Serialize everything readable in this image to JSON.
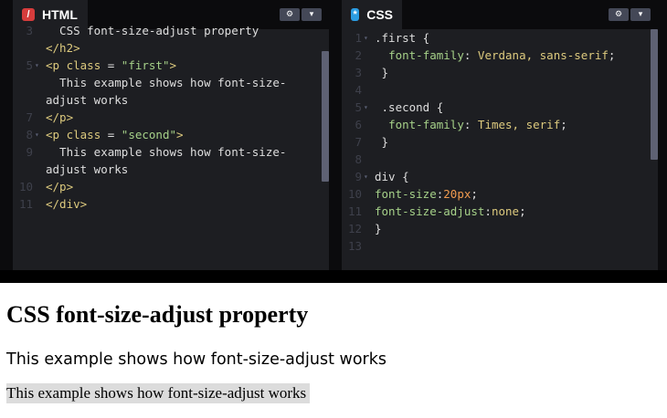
{
  "colors": {
    "tag": "#ddca7e",
    "attr": "#ddca7e",
    "string": "#a6d189",
    "property": "#a6d189",
    "number": "#f09a4f",
    "text": "#dedede",
    "html_icon": "#d63c3c",
    "css_icon": "#2b9de3",
    "second_paragraph_highlight": "#dcdcdc"
  },
  "html_pane": {
    "tab_label": "HTML",
    "icon": "html-slash-icon",
    "icon_glyph": "/",
    "lines": [
      {
        "num": "3",
        "fold": "",
        "text": "  CSS font-size-adjust property"
      },
      {
        "num": "",
        "fold": "",
        "text": "</h2>"
      },
      {
        "num": "5",
        "fold": "▾",
        "text": "<p class = \"first\">"
      },
      {
        "num": "",
        "fold": "",
        "text": "  This example shows how font-size-"
      },
      {
        "num": "",
        "fold": "",
        "text": "adjust works"
      },
      {
        "num": "7",
        "fold": "",
        "text": "</p>"
      },
      {
        "num": "8",
        "fold": "▾",
        "text": "<p class = \"second\">"
      },
      {
        "num": "9",
        "fold": "",
        "text": "  This example shows how font-size-"
      },
      {
        "num": "",
        "fold": "",
        "text": "adjust works"
      },
      {
        "num": "10",
        "fold": "",
        "text": "</p>"
      },
      {
        "num": "11",
        "fold": "",
        "text": "</div>"
      }
    ]
  },
  "css_pane": {
    "tab_label": "CSS",
    "icon": "css-asterisk-icon",
    "icon_glyph": "*",
    "lines": [
      {
        "num": "1",
        "fold": "▾",
        "text": ".first {"
      },
      {
        "num": "2",
        "fold": "",
        "text": "  font-family: Verdana, sans-serif;"
      },
      {
        "num": "3",
        "fold": "",
        "text": " }"
      },
      {
        "num": "4",
        "fold": "",
        "text": ""
      },
      {
        "num": "5",
        "fold": "▾",
        "text": " .second {"
      },
      {
        "num": "6",
        "fold": "",
        "text": "  font-family: Times, serif;"
      },
      {
        "num": "7",
        "fold": "",
        "text": " }"
      },
      {
        "num": "8",
        "fold": "",
        "text": ""
      },
      {
        "num": "9",
        "fold": "▾",
        "text": "div {"
      },
      {
        "num": "10",
        "fold": "",
        "text": "font-size:20px;"
      },
      {
        "num": "11",
        "fold": "",
        "text": "font-size-adjust:none;"
      },
      {
        "num": "12",
        "fold": "",
        "text": "}"
      },
      {
        "num": "13",
        "fold": "",
        "text": ""
      }
    ]
  },
  "pane_buttons": {
    "settings_icon": "gear-icon",
    "settings_glyph": "⚙",
    "collapse_icon": "chevron-down-icon",
    "collapse_glyph": "▾"
  },
  "result": {
    "heading": "CSS font-size-adjust property",
    "first_paragraph": "This example shows how font-size-adjust works",
    "second_paragraph": "This example shows how font-size-adjust works"
  }
}
